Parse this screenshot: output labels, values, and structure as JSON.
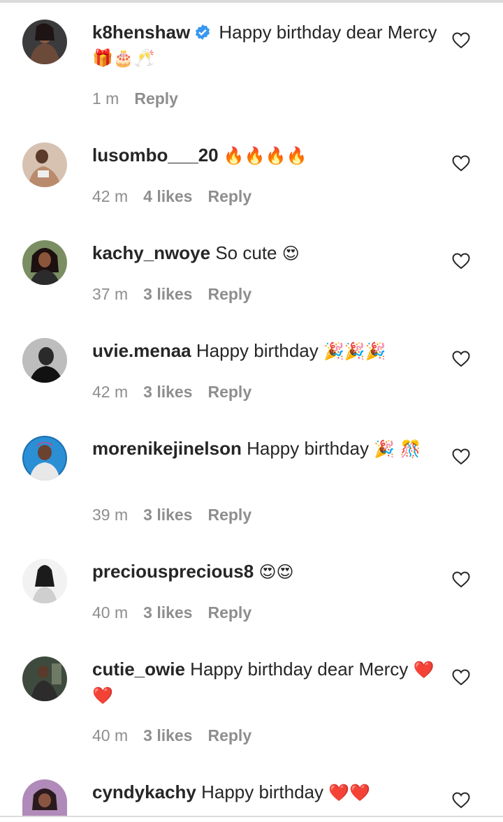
{
  "comments": [
    {
      "username": "k8henshaw",
      "verified": true,
      "text": "Happy birthday dear Mercy",
      "emojis": "🎁🎂🥂",
      "time": "1 m",
      "likes": "",
      "reply": "Reply"
    },
    {
      "username": "lusombo___20",
      "verified": false,
      "text": "",
      "emojis": "🔥🔥🔥🔥",
      "time": "42 m",
      "likes": "4 likes",
      "reply": "Reply"
    },
    {
      "username": "kachy_nwoye",
      "verified": false,
      "text": "So cute",
      "emojis": "😍",
      "time": "37 m",
      "likes": "3 likes",
      "reply": "Reply"
    },
    {
      "username": "uvie.menaa",
      "verified": false,
      "text": "Happy birthday",
      "emojis": "🎉🎉🎉",
      "time": "42 m",
      "likes": "3 likes",
      "reply": "Reply"
    },
    {
      "username": "morenikejinelson",
      "verified": false,
      "text": "Happy birthday",
      "emojis": "🎉 🎊",
      "time": "39 m",
      "likes": "3 likes",
      "reply": "Reply"
    },
    {
      "username": "preciousprecious8",
      "verified": false,
      "text": "",
      "emojis": "😍😍",
      "time": "40 m",
      "likes": "3 likes",
      "reply": "Reply"
    },
    {
      "username": "cutie_owie",
      "verified": false,
      "text": "Happy birthday dear Mercy",
      "emojis": "❤️❤️",
      "time": "40 m",
      "likes": "3 likes",
      "reply": "Reply"
    },
    {
      "username": "cyndykachy",
      "verified": false,
      "text": "Happy birthday",
      "emojis": "❤️❤️",
      "time": "",
      "likes": "",
      "reply": ""
    }
  ],
  "icons": {
    "heart": "heart-outline-icon",
    "verified": "verified-badge-icon"
  },
  "colors": {
    "text": "#262626",
    "meta": "#8e8e8e",
    "verified": "#3897f0",
    "divider": "#dbdbdb"
  }
}
